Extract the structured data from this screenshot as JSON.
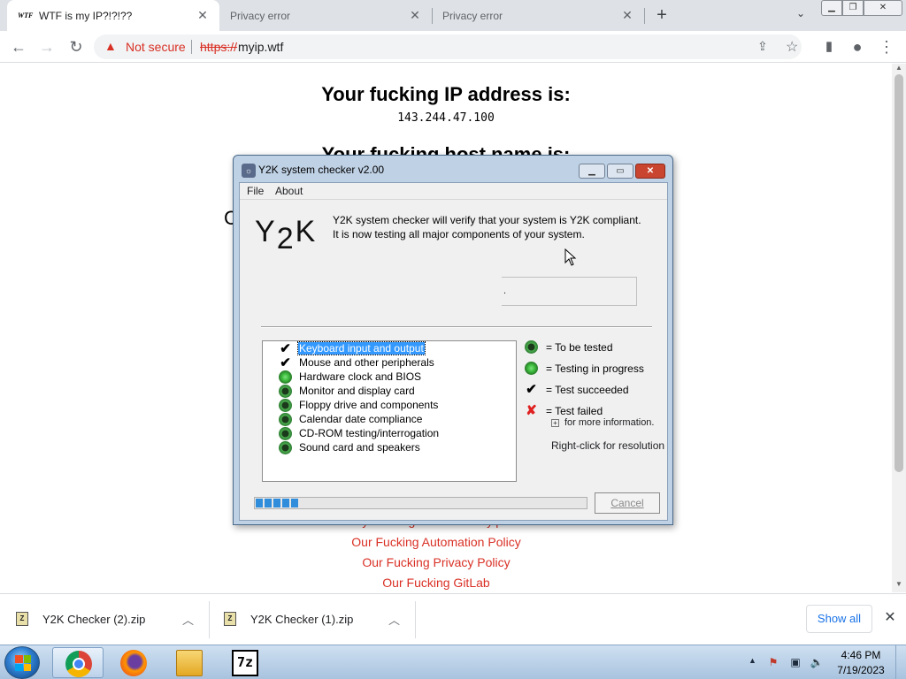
{
  "browser": {
    "tabs": [
      {
        "label": "WTF is my IP?!?!??",
        "favicon": "WTF",
        "active": true
      },
      {
        "label": "Privacy error",
        "active": false
      },
      {
        "label": "Privacy error",
        "active": false
      }
    ],
    "new_tab": "+",
    "address": {
      "security_label": "Not secure",
      "scheme": "https://",
      "host": "myip.wtf"
    }
  },
  "page": {
    "heading": "Your fucking IP address is:",
    "ip": "143.244.47.100",
    "heading2": "Your fucking host name is:",
    "links": [
      "Why Fucking Use What.myip.wtf?",
      "Our Fucking Automation Policy",
      "Our Fucking Privacy Policy",
      "Our Fucking GitLab"
    ]
  },
  "dialog": {
    "title": "Y2K system checker v2.00",
    "menu": [
      "File",
      "About"
    ],
    "logo": {
      "a": "Y",
      "b": "2",
      "c": "K"
    },
    "intro_line1": "Y2K system checker will verify that your system is Y2K compliant.",
    "intro_line2": "It is now testing all major components of your system.",
    "status_text": ".",
    "tests": [
      {
        "label": "Keyboard input and output",
        "state": "succeeded",
        "selected": true
      },
      {
        "label": "Mouse and other peripherals",
        "state": "succeeded",
        "selected": false
      },
      {
        "label": "Hardware clock and BIOS",
        "state": "in_progress",
        "selected": false
      },
      {
        "label": "Monitor and display card",
        "state": "to_be_tested",
        "selected": false
      },
      {
        "label": "Floppy drive and components",
        "state": "to_be_tested",
        "selected": false
      },
      {
        "label": "Calendar date compliance",
        "state": "to_be_tested",
        "selected": false
      },
      {
        "label": "CD-ROM testing/interrogation",
        "state": "to_be_tested",
        "selected": false
      },
      {
        "label": "Sound card and speakers",
        "state": "to_be_tested",
        "selected": false
      }
    ],
    "legend": {
      "to_be_tested": "= To be tested",
      "in_progress": "= Testing in progress",
      "succeeded": "= Test succeeded",
      "failed": "= Test failed",
      "more_info": "for more information.",
      "right_click": "Right-click for resolution"
    },
    "progress_blocks": 5,
    "cancel_label": "Cancel"
  },
  "downloads": {
    "items": [
      {
        "name": "Y2K Checker (2).zip"
      },
      {
        "name": "Y2K Checker (1).zip"
      }
    ],
    "show_all": "Show all"
  },
  "taskbar": {
    "apps": [
      "chrome",
      "firefox",
      "explorer",
      "7-zip"
    ],
    "seven_zip_label": "7z",
    "time": "4:46 PM",
    "date": "7/19/2023"
  },
  "colors": {
    "insecure_red": "#d93025",
    "link_blue": "#1a73e8",
    "progress_blue": "#2f8ddc",
    "selection_blue": "#3399ff"
  }
}
